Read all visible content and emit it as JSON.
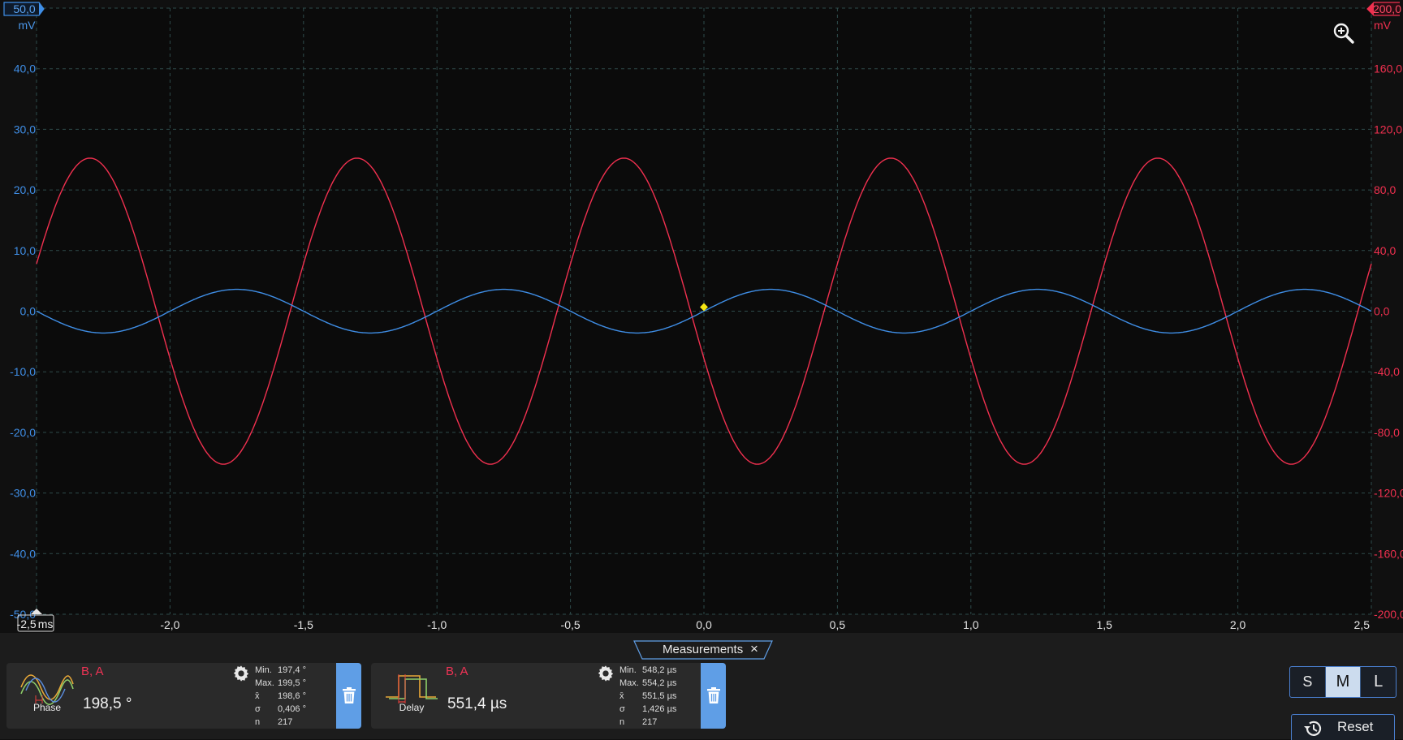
{
  "colors": {
    "background": "#101010",
    "grid": "#2e4b4b",
    "channel_a": "#3f8ee6",
    "channel_b": "#f0304f",
    "trigger_marker": "#f5e614",
    "panel": "#2a2a2a",
    "accent": "#5f9ee6"
  },
  "scope": {
    "left_axis": {
      "scale_badge": "50,0",
      "unit": "mV",
      "ticks": [
        "40,0",
        "30,0",
        "20,0",
        "10,0",
        "0,0",
        "-10,0",
        "-20,0",
        "-30,0",
        "-40,0",
        "-50,0"
      ]
    },
    "right_axis": {
      "scale_badge": "200,0",
      "unit": "mV",
      "ticks": [
        "160,0",
        "120,0",
        "80,0",
        "40,0",
        "0,0",
        "-40,0",
        "-80,0",
        "-120,0",
        "-160,0",
        "-200,0"
      ]
    },
    "x_axis": {
      "first_label": "-2,5",
      "first_unit": "ms",
      "ticks": [
        "-2,0",
        "-1,5",
        "-1,0",
        "-0,5",
        "0,0",
        "0,5",
        "1,0",
        "1,5",
        "2,0",
        "2,5"
      ]
    },
    "zoom_icon": "zoom-in-icon"
  },
  "chart_data": {
    "type": "line",
    "x_unit": "ms",
    "xlim": [
      -2.5,
      2.5
    ],
    "grid": true,
    "series": [
      {
        "channel": "A",
        "axis": "left",
        "unit": "mV",
        "ylim": [
          -50,
          50
        ],
        "color": "#3f8ee6",
        "amplitude": 3.6,
        "period_ms": 1.0,
        "points": [
          {
            "x": -2.5,
            "y": 0.0
          },
          {
            "x": -2.25,
            "y": -3.6
          },
          {
            "x": -2.0,
            "y": 0.0
          },
          {
            "x": -1.75,
            "y": 3.6
          },
          {
            "x": -1.5,
            "y": 0.0
          },
          {
            "x": -1.25,
            "y": -3.6
          },
          {
            "x": -1.0,
            "y": 0.0
          },
          {
            "x": -0.75,
            "y": 3.6
          },
          {
            "x": -0.5,
            "y": 0.0
          },
          {
            "x": -0.25,
            "y": -3.6
          },
          {
            "x": 0.0,
            "y": 0.0
          },
          {
            "x": 0.25,
            "y": 3.6
          },
          {
            "x": 0.5,
            "y": 0.0
          },
          {
            "x": 0.75,
            "y": -3.6
          },
          {
            "x": 1.0,
            "y": 0.0
          },
          {
            "x": 1.25,
            "y": 3.6
          },
          {
            "x": 1.5,
            "y": 0.0
          },
          {
            "x": 1.75,
            "y": -3.6
          },
          {
            "x": 2.0,
            "y": 0.0
          },
          {
            "x": 2.25,
            "y": 3.6
          },
          {
            "x": 2.5,
            "y": 0.0
          }
        ]
      },
      {
        "channel": "B",
        "axis": "right",
        "unit": "mV",
        "ylim": [
          -200,
          200
        ],
        "color": "#f0304f",
        "amplitude": 101,
        "period_ms": 1.0,
        "points": [
          {
            "x": -2.5,
            "y": 18.0
          },
          {
            "x": -2.3,
            "y": 101.0
          },
          {
            "x": -2.05,
            "y": 0.0
          },
          {
            "x": -1.8,
            "y": -101.0
          },
          {
            "x": -1.55,
            "y": 0.0
          },
          {
            "x": -1.3,
            "y": 101.0
          },
          {
            "x": -1.05,
            "y": 0.0
          },
          {
            "x": -0.8,
            "y": -101.0
          },
          {
            "x": -0.55,
            "y": 0.0
          },
          {
            "x": -0.3,
            "y": 101.0
          },
          {
            "x": -0.05,
            "y": 0.0
          },
          {
            "x": 0.2,
            "y": -101.0
          },
          {
            "x": 0.45,
            "y": 0.0
          },
          {
            "x": 0.7,
            "y": 101.0
          },
          {
            "x": 0.95,
            "y": 0.0
          },
          {
            "x": 1.2,
            "y": -101.0
          },
          {
            "x": 1.45,
            "y": 0.0
          },
          {
            "x": 1.7,
            "y": 101.0
          },
          {
            "x": 1.95,
            "y": 0.0
          },
          {
            "x": 2.2,
            "y": -101.0
          },
          {
            "x": 2.45,
            "y": 0.0
          },
          {
            "x": 2.5,
            "y": 18.0
          }
        ]
      }
    ],
    "trigger": {
      "x": 0.0,
      "y": 0.0
    }
  },
  "measurements": {
    "title": "Measurements",
    "close_glyph": "×",
    "cards": [
      {
        "icon": "phase-waveform-icon",
        "icon_label": "Phase",
        "channels": "B, A",
        "value": "198,5 °",
        "stats": [
          {
            "k": "Min.",
            "v": "197,4 °"
          },
          {
            "k": "Max.",
            "v": "199,5 °"
          },
          {
            "k": "x̄",
            "v": "198,6 °"
          },
          {
            "k": "σ",
            "v": "0,406 °"
          },
          {
            "k": "n",
            "v": "217"
          }
        ]
      },
      {
        "icon": "delay-pulse-icon",
        "icon_label": "Delay",
        "channels": "B, A",
        "value": "551,4 µs",
        "stats": [
          {
            "k": "Min.",
            "v": "548,2 µs"
          },
          {
            "k": "Max.",
            "v": "554,2 µs"
          },
          {
            "k": "x̄",
            "v": "551,5 µs"
          },
          {
            "k": "σ",
            "v": "1,426 µs"
          },
          {
            "k": "n",
            "v": "217"
          }
        ]
      }
    ]
  },
  "view_size": {
    "options": [
      "S",
      "M",
      "L"
    ],
    "selected": "M"
  },
  "reset": {
    "label": "Reset"
  }
}
